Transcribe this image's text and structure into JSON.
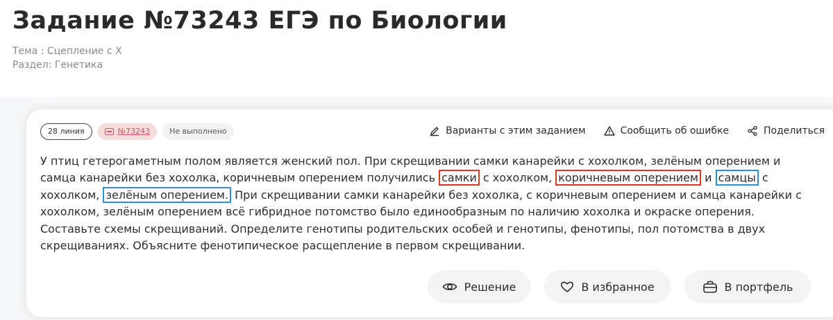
{
  "title": "Задание №73243 ЕГЭ по Биологии",
  "topic": "Тема : Сцепление с X",
  "section": "Раздел: Генетика",
  "tags": {
    "line": "28 линия",
    "number": "№73243",
    "status": "Не выполнено"
  },
  "actions": {
    "variants": "Варианты с этим заданием",
    "report": "Сообщить об ошибке",
    "share": "Поделиться"
  },
  "task": {
    "p1": "У птиц гетерогаметным полом является женский пол. При скрещивании самки канарейки с хохолком, зелёным оперением и самца канарейки без хохолка, коричневым оперением получились ",
    "h1": "самки",
    "p2": " с хохолком, ",
    "h2": "коричневым оперением",
    "p3": " и ",
    "h3": "самцы",
    "p4": " с хохолком, ",
    "h4": "зелёным оперением.",
    "p5": " При скрещивании самки канарейки без хохолка, с коричневым оперением и самца канарейки с хохолком, зелёным оперением всё гибридное потомство было единообразным по наличию хохолка и окраске оперения. Составьте схемы скрещиваний. Определите генотипы родительских особей и генотипы, фенотипы, пол потомства в двух скрещиваниях. Объясните фенотипическое расщепление в первом скрещивании."
  },
  "buttons": {
    "solution": "Решение",
    "favorite": "В избранное",
    "portfolio": "В портфель"
  },
  "icons": {
    "variants": "pencil-icon",
    "report": "warning-icon",
    "share": "share-icon",
    "solution": "eye-icon",
    "favorite": "heart-icon",
    "portfolio": "briefcase-icon",
    "tag_number": "box-icon"
  },
  "colors": {
    "highlight_red": "#d6382b",
    "highlight_blue": "#2a8fd6",
    "tag_pink": "#f8dcdd"
  }
}
